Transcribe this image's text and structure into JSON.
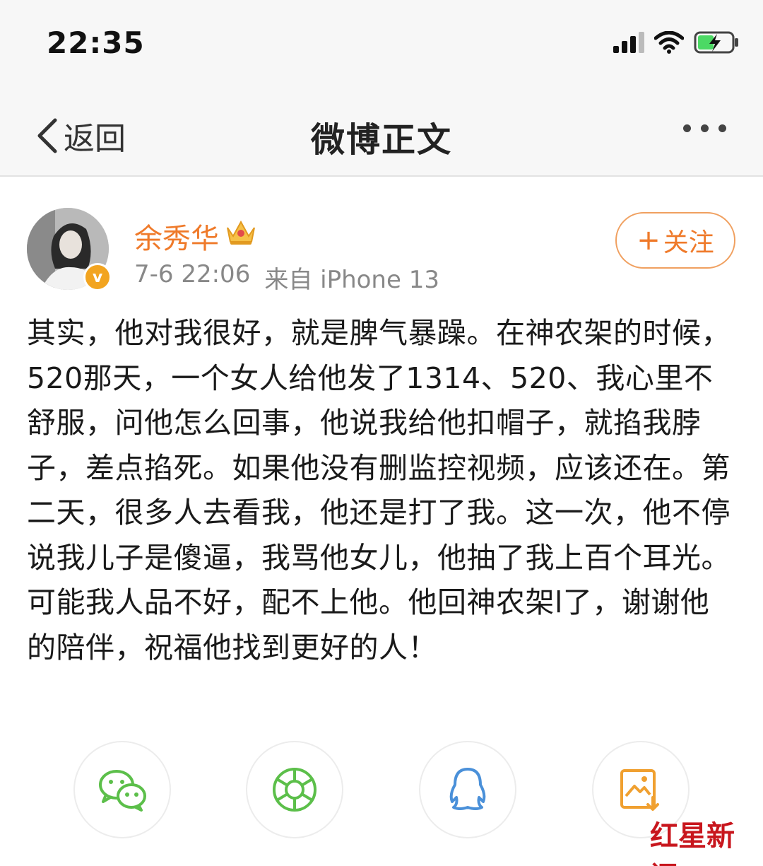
{
  "status_bar": {
    "time": "22:35"
  },
  "nav": {
    "back_label": "返回",
    "title": "微博正文"
  },
  "post": {
    "username": "余秀华",
    "date": "7-6 22:06",
    "source": "来自 iPhone 13",
    "follow_label": "关注",
    "verified_mark": "v",
    "text": "其实，他对我很好，就是脾气暴躁。在神农架的时候，520那天，一个女人给他发了1314、520、我心里不舒服，问他怎么回事，他说我给他扣帽子，就掐我脖子，差点掐死。如果他没有删监控视频，应该还在。第二天，很多人去看我，他还是打了我。这一次，他不停说我儿子是傻逼，我骂他女儿，他抽了我上百个耳光。可能我人品不好，配不上他。他回神农架l了，谢谢他的陪伴，祝福他找到更好的人！"
  },
  "share": [
    {
      "icon": "wechat-icon"
    },
    {
      "icon": "moments-icon"
    },
    {
      "icon": "qq-icon"
    },
    {
      "icon": "save-image-icon"
    }
  ],
  "watermark": {
    "text": "红星新闻"
  },
  "colors": {
    "accent": "#ef7a2a",
    "share_green": "#5cbf4a",
    "share_blue": "#4a90d9",
    "share_orange": "#f0a030"
  }
}
